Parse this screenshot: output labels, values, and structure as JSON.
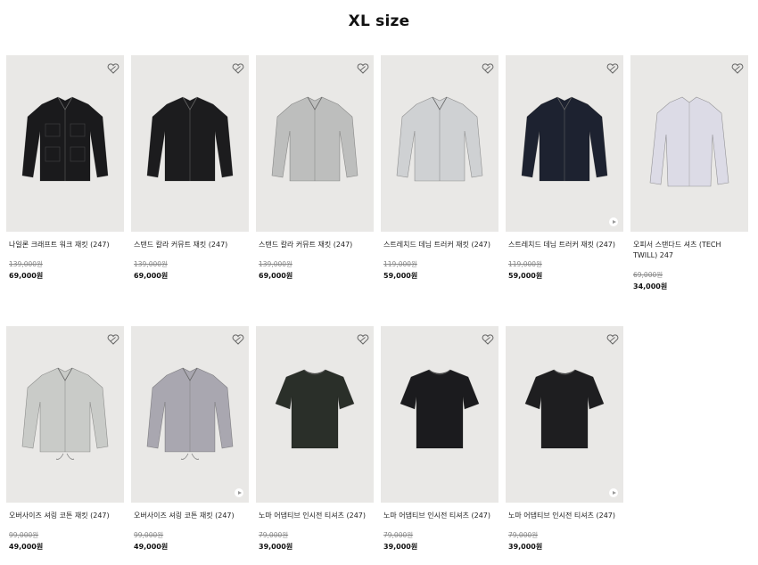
{
  "page": {
    "title": "XL size"
  },
  "products": [
    {
      "name": "나일론 크래프트 워크 재킷 (247)",
      "old_price": "139,000원",
      "price": "69,000원",
      "color": "#1a1a1c",
      "type": "jacket",
      "play": false
    },
    {
      "name": "스탠드 칼라 커뮤트 재킷 (247)",
      "old_price": "139,000원",
      "price": "69,000원",
      "color": "#1c1c1e",
      "type": "stand",
      "play": false
    },
    {
      "name": "스탠드 칼라 커뮤트 재킷 (247)",
      "old_price": "139,000원",
      "price": "69,000원",
      "color": "#bdbebd",
      "type": "stand",
      "play": false
    },
    {
      "name": "스트레치드 데님 트러커 재킷 (247)",
      "old_price": "119,000원",
      "price": "59,000원",
      "color": "#cfd1d3",
      "type": "trucker",
      "play": false
    },
    {
      "name": "스트레치드 데님 트러커 재킷 (247)",
      "old_price": "119,000원",
      "price": "59,000원",
      "color": "#1d2230",
      "type": "trucker",
      "play": true
    },
    {
      "name": "오피서 스탠다드 셔츠 (TECH TWILL) 247",
      "old_price": "69,000원",
      "price": "34,000원",
      "color": "#dcdbe6",
      "type": "shirt",
      "play": false
    },
    {
      "name": "오버사이즈 셔링 코튼 재킷 (247)",
      "old_price": "99,000원",
      "price": "49,000원",
      "color": "#c9cbc8",
      "type": "camp",
      "play": false
    },
    {
      "name": "오버사이즈 셔링 코튼 재킷 (247)",
      "old_price": "99,000원",
      "price": "49,000원",
      "color": "#a9a7b0",
      "type": "camp",
      "play": true
    },
    {
      "name": "노마 어댑티브 인시전 티셔츠 (247)",
      "old_price": "79,000원",
      "price": "39,000원",
      "color": "#2a2f29",
      "type": "tee",
      "play": false
    },
    {
      "name": "노마 어댑티브 인시전 티셔츠 (247)",
      "old_price": "79,000원",
      "price": "39,000원",
      "color": "#1b1b1e",
      "type": "tee",
      "play": false
    },
    {
      "name": "노마 어댑티브 인시전 티셔츠 (247)",
      "old_price": "79,000원",
      "price": "39,000원",
      "color": "#1e1e20",
      "type": "tee",
      "play": true
    }
  ],
  "icons": {
    "favorite": "heart-outline-icon",
    "play": "play-icon"
  }
}
